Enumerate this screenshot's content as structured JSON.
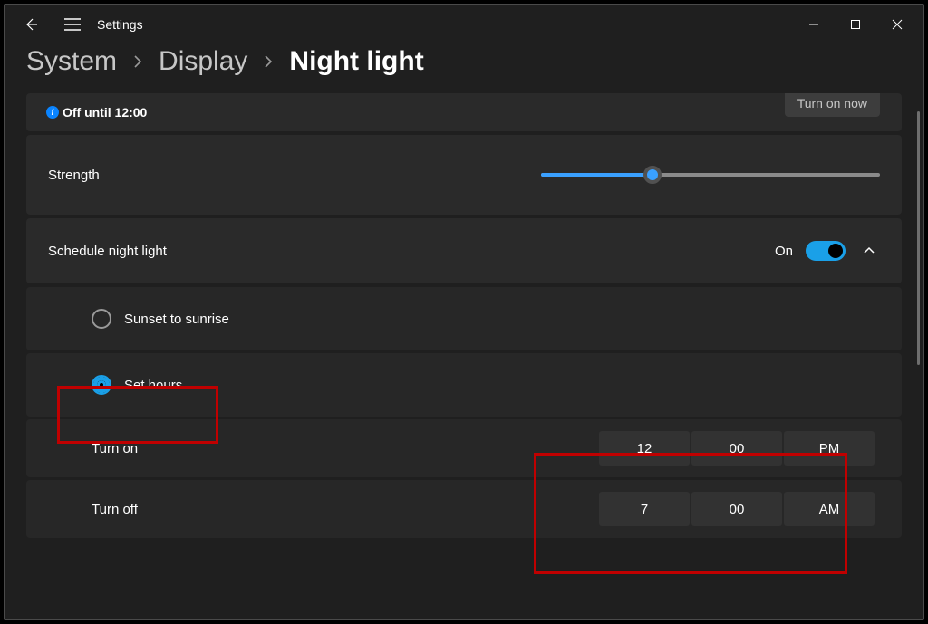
{
  "app_title": "Settings",
  "breadcrumb": {
    "item1": "System",
    "item2": "Display",
    "item3": "Night light"
  },
  "status": {
    "text": "Off until 12:00",
    "button": "Turn on now"
  },
  "strength": {
    "label": "Strength",
    "value_pct": 33
  },
  "schedule": {
    "label": "Schedule night light",
    "state": "On"
  },
  "radio": {
    "sunset": "Sunset to sunrise",
    "sethours": "Set hours"
  },
  "turn_on": {
    "label": "Turn on",
    "hour": "12",
    "minute": "00",
    "ampm": "PM"
  },
  "turn_off": {
    "label": "Turn off",
    "hour": "7",
    "minute": "00",
    "ampm": "AM"
  }
}
